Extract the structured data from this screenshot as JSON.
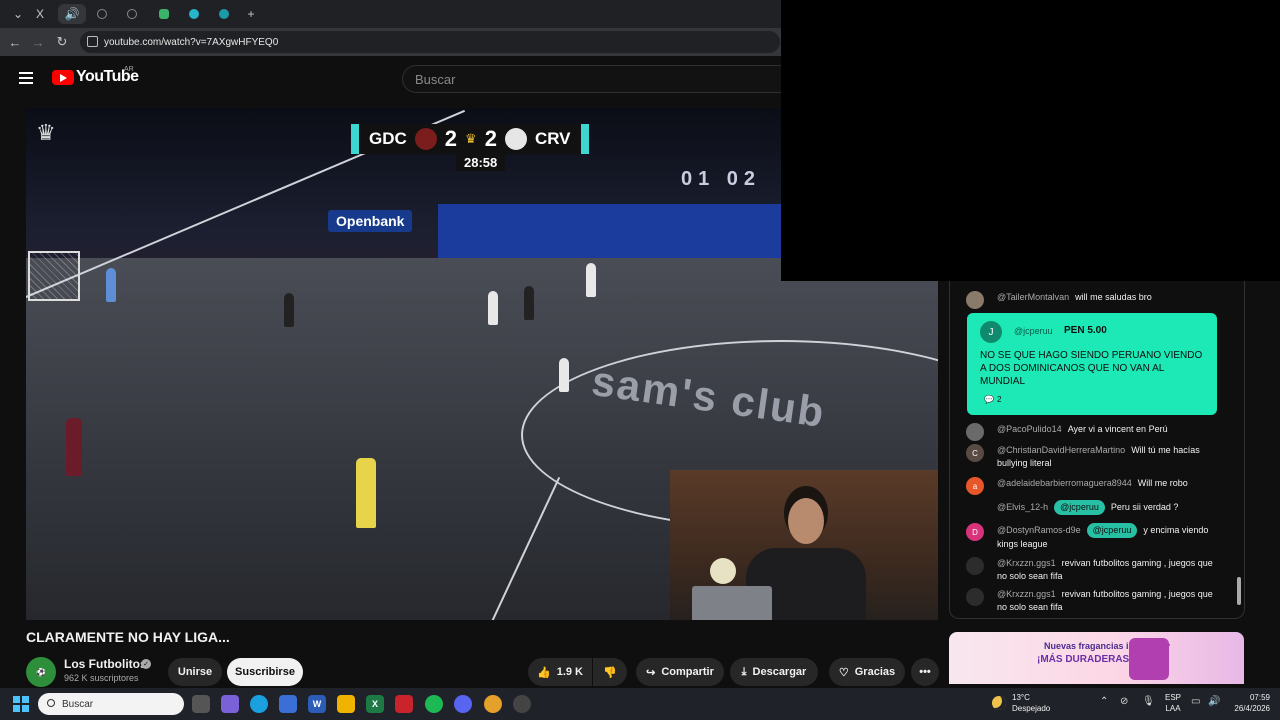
{
  "browser": {
    "tabs": [
      "X",
      "🔊",
      "",
      "",
      "",
      "",
      ""
    ],
    "new_tab": "+",
    "url": "youtube.com/watch?v=7AXgwHFYEQ0"
  },
  "youtube": {
    "logo_text": "YouTube",
    "country": "AR",
    "search_placeholder": "Buscar"
  },
  "video": {
    "scoreboard": {
      "home": "GDC",
      "home_score": "2",
      "away_score": "2",
      "away": "CRV",
      "clock": "28:58"
    },
    "sponsor": "sam's club",
    "banner": "Openbank",
    "screen_numbers": "01 02"
  },
  "details": {
    "title": "CLARAMENTE NO HAY LIGA...",
    "channel": "Los Futbolitos",
    "subscribers": "962 K suscriptores",
    "join_label": "Unirse",
    "subscribe_label": "Suscribirse",
    "like_count": "1.9 K",
    "share_label": "Compartir",
    "download_label": "Descargar",
    "thanks_label": "Gracias"
  },
  "chat": {
    "messages": [
      {
        "author": "@TailerMontalvan",
        "text": "will me saludas bro",
        "avatar_color": "#8a7a6a",
        "initial": ""
      },
      {
        "author": "@PacoPulido14",
        "text": "Ayer vi a vincent en Perú",
        "avatar_color": "#6a6a6a",
        "initial": ""
      },
      {
        "author": "@ChristianDavidHerreraMartino",
        "text": "Will tú me hacías bullying literal",
        "avatar_color": "#5a4a44",
        "initial": "C"
      },
      {
        "author": "@adelaidebarbierromaguera8944",
        "text": "Will me robo",
        "avatar_color": "#e8572a",
        "initial": "a"
      },
      {
        "author": "@Elvis_12-h",
        "mention": "@jcperuu",
        "text": "Peru sii verdad ?",
        "avatar_color": "#0f0f0f",
        "initial": ""
      },
      {
        "author": "@DostynRamos-d9e",
        "mention": "@jcperuu",
        "text": "y encima viendo kings league",
        "avatar_color": "#d6337a",
        "initial": "D"
      },
      {
        "author": "@Krxzzn.ggs1",
        "text": "revivan futbolitos gaming , juegos que no solo sean fifa",
        "avatar_color": "#2c2c2c",
        "initial": ""
      },
      {
        "author": "@Krxzzn.ggs1",
        "text": "revivan futbolitos gaming , juegos que no solo sean fifa",
        "avatar_color": "#2c2c2c",
        "initial": ""
      }
    ],
    "superchat": {
      "author": "@jcperuu",
      "initial": "J",
      "amount": "PEN 5.00",
      "text": "NO SE QUE HAGO SIENDO PERUANO VIENDO A DOS DOMINICANOS QUE NO VAN AL MUNDIAL",
      "replies": "2",
      "color": "#1de9b6"
    }
  },
  "ad": {
    "line1": "Nuevas fragancias intensas y",
    "line2": "¡MÁS DURADERAS!"
  },
  "taskbar": {
    "search_placeholder": "Buscar",
    "weather_temp": "13°C",
    "weather_desc": "Despejado",
    "lang1": "ESP",
    "lang2": "LAA",
    "time": "07:59",
    "date": "26/4/2026"
  }
}
